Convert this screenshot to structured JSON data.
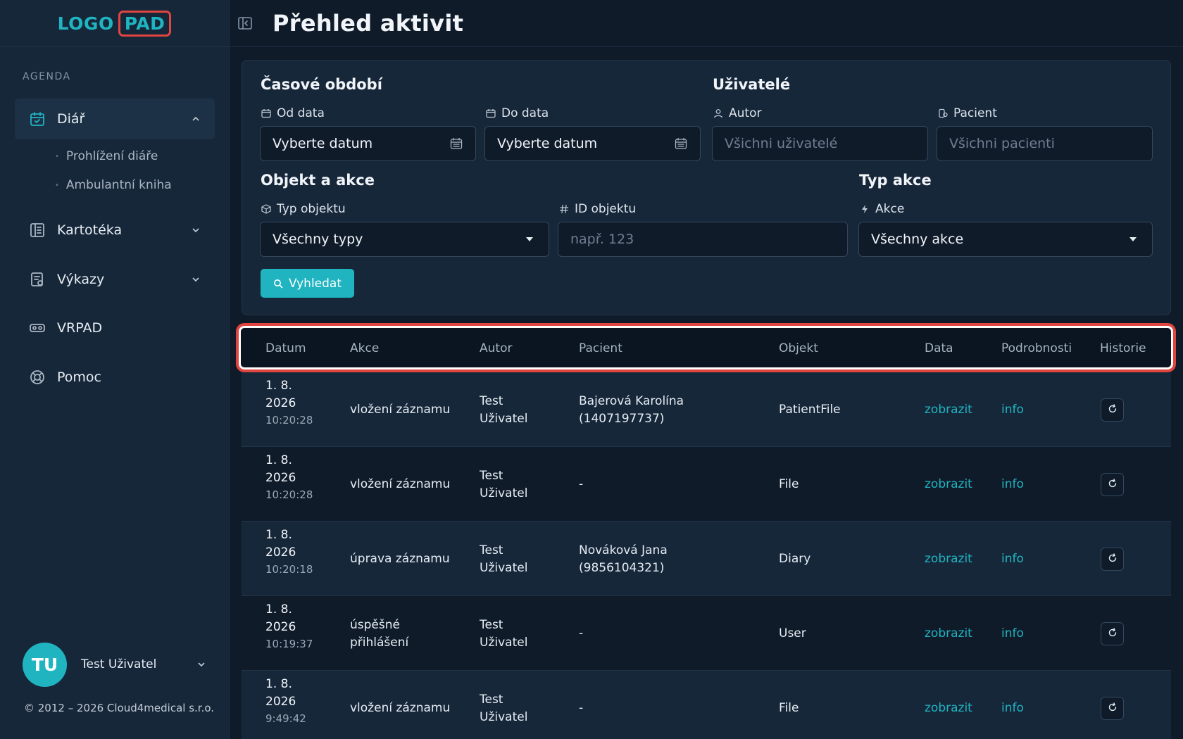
{
  "sidebar": {
    "logo": {
      "part1": "LOGO",
      "part2": "PAD"
    },
    "section_label": "AGENDA",
    "items": [
      {
        "label": "Diář",
        "icon": "calendar-check-icon",
        "expanded": true,
        "children": [
          "Prohlížení diáře",
          "Ambulantní kniha"
        ]
      },
      {
        "label": "Kartotéka",
        "icon": "file-cabinet-icon"
      },
      {
        "label": "Výkazy",
        "icon": "report-icon"
      },
      {
        "label": "VRPAD",
        "icon": "vr-headset-icon"
      },
      {
        "label": "Pomoc",
        "icon": "lifebuoy-icon"
      }
    ],
    "user": {
      "initials": "TU",
      "name": "Test Uživatel"
    },
    "copyright": "© 2012 – 2026 Cloud4medical s.r.o."
  },
  "header": {
    "title": "Přehled aktivit"
  },
  "filters": {
    "period": {
      "title": "Časové období",
      "from_label": "Od data",
      "from_value": "Vyberte datum",
      "to_label": "Do data",
      "to_value": "Vyberte datum"
    },
    "users": {
      "title": "Uživatelé",
      "author_label": "Autor",
      "author_placeholder": "Všichni uživatelé",
      "patient_label": "Pacient",
      "patient_placeholder": "Všichni pacienti"
    },
    "object": {
      "title": "Objekt a akce",
      "type_label": "Typ objektu",
      "type_value": "Všechny typy",
      "id_label": "ID objektu",
      "id_placeholder": "např. 123"
    },
    "action_type": {
      "title": "Typ akce",
      "action_label": "Akce",
      "action_value": "Všechny akce"
    },
    "search_label": "Vyhledat"
  },
  "table": {
    "columns": [
      "Datum",
      "Akce",
      "Autor",
      "Pacient",
      "Objekt",
      "Data",
      "Podrobnosti",
      "Historie"
    ],
    "rows": [
      {
        "date": "1. 8.",
        "year": "2026",
        "time": "10:20:28",
        "action": "vložení záznamu",
        "author1": "Test",
        "author2": "Uživatel",
        "patient1": "Bajerová Karolína",
        "patient2": "(1407197737)",
        "object": "PatientFile",
        "data": "zobrazit",
        "details": "info"
      },
      {
        "date": "1. 8.",
        "year": "2026",
        "time": "10:20:28",
        "action": "vložení záznamu",
        "author1": "Test",
        "author2": "Uživatel",
        "patient1": "-",
        "patient2": "",
        "object": "File",
        "data": "zobrazit",
        "details": "info"
      },
      {
        "date": "1. 8.",
        "year": "2026",
        "time": "10:20:18",
        "action": "úprava záznamu",
        "author1": "Test",
        "author2": "Uživatel",
        "patient1": "Nováková Jana",
        "patient2": "(9856104321)",
        "object": "Diary",
        "data": "zobrazit",
        "details": "info"
      },
      {
        "date": "1. 8.",
        "year": "2026",
        "time": "10:19:37",
        "action": "úspěšné přihlášení",
        "author1": "Test",
        "author2": "Uživatel",
        "patient1": "-",
        "patient2": "",
        "object": "User",
        "data": "zobrazit",
        "details": "info"
      },
      {
        "date": "1. 8.",
        "year": "2026",
        "time": "9:49:42",
        "action": "vložení záznamu",
        "author1": "Test",
        "author2": "Uživatel",
        "patient1": "-",
        "patient2": "",
        "object": "File",
        "data": "zobrazit",
        "details": "info"
      }
    ]
  },
  "colors": {
    "accent": "#1fb4c0",
    "highlight": "#e0453f",
    "sidebar_bg": "#17273a",
    "page_bg": "#101b2a"
  }
}
